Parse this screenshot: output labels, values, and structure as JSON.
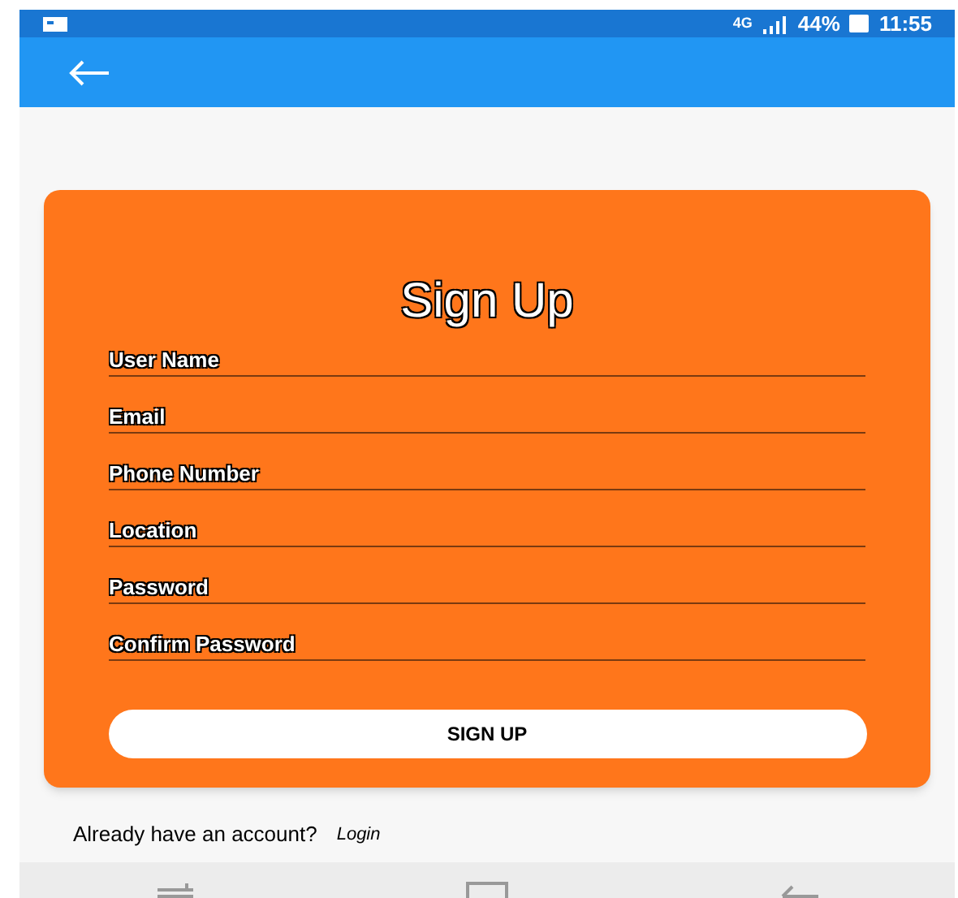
{
  "status_bar": {
    "network": "4G",
    "battery": "44%",
    "time": "11:55"
  },
  "form": {
    "title": "Sign Up",
    "fields": [
      {
        "placeholder": "User Name"
      },
      {
        "placeholder": "Email"
      },
      {
        "placeholder": "Phone Number"
      },
      {
        "placeholder": "Location"
      },
      {
        "placeholder": "Password"
      },
      {
        "placeholder": "Confirm Password"
      }
    ],
    "submit": "SIGN UP"
  },
  "footer": {
    "prompt": "Already have an account?",
    "link": "Login"
  }
}
